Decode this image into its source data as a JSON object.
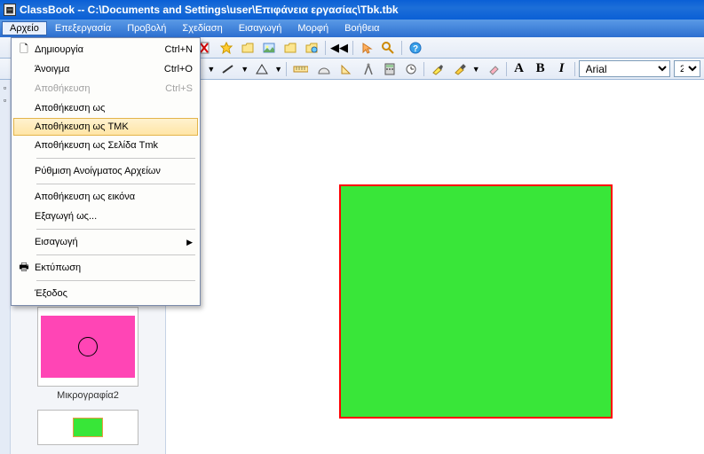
{
  "title": "ClassBook -- C:\\Documents and Settings\\user\\Επιφάνεια εργασίας\\Tbk.tbk",
  "menubar": {
    "items": [
      "Αρχείο",
      "Επεξεργασία",
      "Προβολή",
      "Σχεδίαση",
      "Εισαγωγή",
      "Μορφή",
      "Βοήθεια"
    ]
  },
  "fileMenu": {
    "items": [
      {
        "label": "Δημιουργία",
        "shortcut": "Ctrl+N"
      },
      {
        "label": "Άνοιγμα",
        "shortcut": "Ctrl+O"
      },
      {
        "label": "Αποθήκευση",
        "shortcut": "Ctrl+S",
        "disabled": true
      },
      {
        "label": "Αποθήκευση ως"
      },
      {
        "label": "Αποθήκευση ως TMK",
        "highlight": true
      },
      {
        "label": "Αποθήκευση ως Σελίδα Tmk"
      },
      {
        "sep": true
      },
      {
        "label": "Ρύθμιση Ανοίγματος Αρχείων"
      },
      {
        "sep": true
      },
      {
        "label": "Αποθήκευση ως εικόνα"
      },
      {
        "label": "Εξαγωγή ως..."
      },
      {
        "sep": true
      },
      {
        "label": "Εισαγωγή",
        "submenu": true
      },
      {
        "sep": true
      },
      {
        "label": "Εκτύπωση"
      },
      {
        "sep": true
      },
      {
        "label": "Έξοδος"
      }
    ]
  },
  "toolbar2": {
    "font": "Arial",
    "size": "2"
  },
  "thumbs": {
    "label2": "Μικρογραφία2"
  }
}
